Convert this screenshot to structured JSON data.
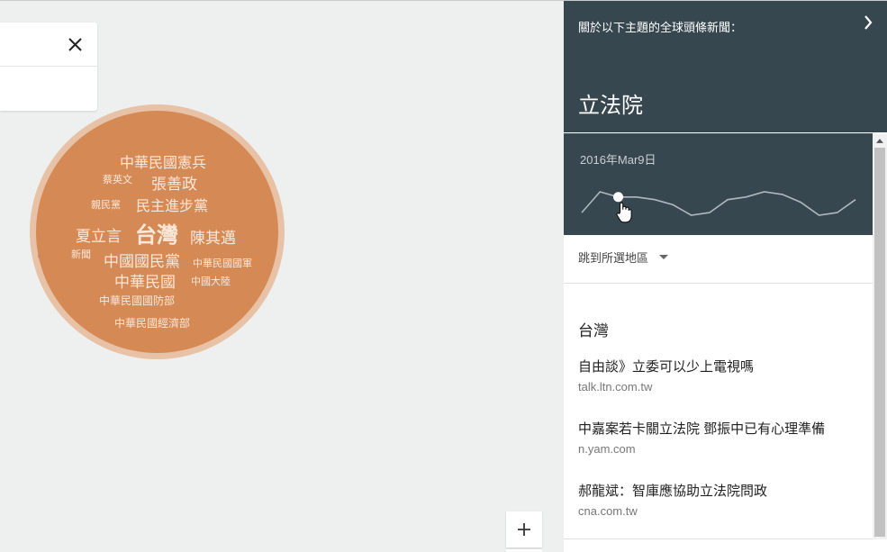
{
  "search_card": {
    "close_icon": "close-icon"
  },
  "bubble": {
    "colors": {
      "outer": "#e8c2a6",
      "inner": "#d58a55",
      "text": "#fbe7d8"
    },
    "words": [
      {
        "text": "中華民國憲兵",
        "size": 16
      },
      {
        "text": "蔡英文",
        "size": 11
      },
      {
        "text": "張善政",
        "size": 17
      },
      {
        "text": "親民黨",
        "size": 11
      },
      {
        "text": "民主進步黨",
        "size": 16
      },
      {
        "text": "夏立言",
        "size": 17
      },
      {
        "text": "台灣",
        "size": 24
      },
      {
        "text": "陳其邁",
        "size": 17
      },
      {
        "text": "新聞",
        "size": 11
      },
      {
        "text": "中國國民黨",
        "size": 17
      },
      {
        "text": "中華民國國軍",
        "size": 11
      },
      {
        "text": "中華民國",
        "size": 17
      },
      {
        "text": "中國大陸",
        "size": 11
      },
      {
        "text": "中華民國國防部",
        "size": 12
      },
      {
        "text": "中華民國經濟部",
        "size": 12
      }
    ]
  },
  "zoom": {
    "icon": "plus-icon"
  },
  "panel": {
    "header_label": "關於以下主題的全球頭條新聞：",
    "topic_title": "立法院",
    "colors": {
      "header_bg": "#37474f"
    },
    "trend": {
      "date": "2016年Mar9日",
      "values": [
        3,
        11,
        9,
        9,
        8,
        6,
        2,
        3,
        8,
        9,
        11,
        10,
        7,
        2,
        3,
        8
      ],
      "selected_index": 2
    },
    "region_select": "跳到所選地區",
    "section_title": "台灣",
    "articles": [
      {
        "headline": "自由談》立委可以少上電視嗎",
        "source": "talk.ltn.com.tw"
      },
      {
        "headline": "中嘉案若卡關立法院 鄧振中已有心理準備",
        "source": "n.yam.com"
      },
      {
        "headline": "郝龍斌：智庫應協助立法院問政",
        "source": "cna.com.tw"
      }
    ]
  }
}
